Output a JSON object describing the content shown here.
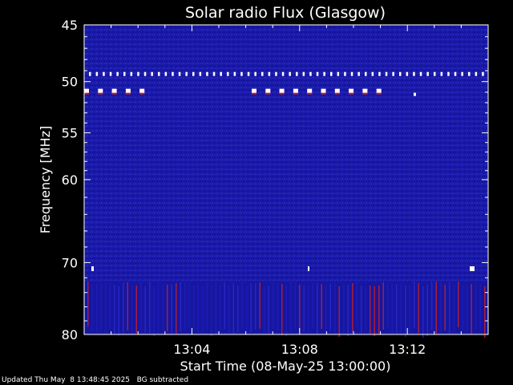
{
  "chart_data": {
    "type": "heatmap",
    "title": "Solar radio Flux (Glasgow)",
    "xlabel": "Start Time (08-May-25 13:00:00)",
    "ylabel": "Frequency [MHz]",
    "x_range_minutes": [
      0,
      15
    ],
    "x_ticks": [
      "13:04",
      "13:08",
      "13:12"
    ],
    "x_tick_minutes": [
      4,
      8,
      12
    ],
    "y_range_mhz": [
      45,
      80
    ],
    "y_ticks": [
      "45",
      "50",
      "55",
      "60",
      "70",
      "80"
    ],
    "y_tick_values": [
      45,
      50,
      55,
      60,
      70,
      80
    ],
    "y_scale": "log",
    "background_color": "#1a1aa6",
    "colors": {
      "low": "#0a0a8c",
      "mid": "#2a2ad0",
      "high": "#ffffff",
      "warm": "#cc2020"
    },
    "interference_bands": [
      {
        "freq_mhz": 49.3,
        "pattern": "periodic dots",
        "color": "#ffffff"
      },
      {
        "freq_mhz": 50.9,
        "pattern": "periodic dashes",
        "color": "#ffffff"
      },
      {
        "freq_mhz": 70.8,
        "pattern": "sparse dots",
        "color": "#ffffff"
      },
      {
        "freq_mhz": [
          72.5,
          80
        ],
        "pattern": "vertical streaks",
        "color": "#cc2020"
      }
    ]
  },
  "footer": {
    "updated": "Updated Thu May  8 13:48:45 2025   BG subtracted"
  }
}
